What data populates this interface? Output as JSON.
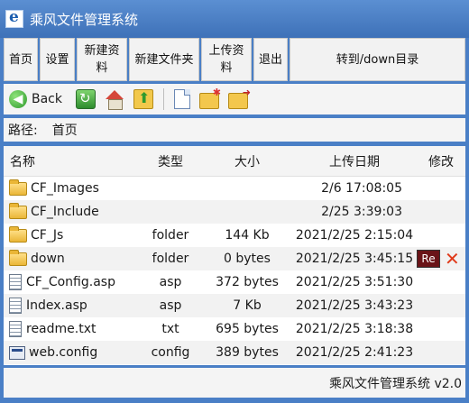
{
  "window": {
    "title": "乘风文件管理系统"
  },
  "nav": {
    "items": [
      {
        "label": "首页"
      },
      {
        "label": "设置"
      },
      {
        "label": "新建资料"
      },
      {
        "label": "新建文件夹"
      },
      {
        "label": "上传资料"
      },
      {
        "label": "退出"
      },
      {
        "label": "转到/down目录"
      }
    ]
  },
  "toolbar": {
    "back_label": "Back",
    "icons": [
      "refresh-icon",
      "home-icon",
      "up-folder-icon",
      "new-file-icon",
      "new-folder-icon",
      "move-folder-icon"
    ]
  },
  "path": {
    "label": "路径:",
    "value": "首页"
  },
  "list": {
    "headers": {
      "name": "名称",
      "type": "类型",
      "size": "大小",
      "date": "上传日期",
      "edit": "修改"
    },
    "rows": [
      {
        "name": "CF_Images",
        "icon": "folder-icon",
        "type": "",
        "size": "",
        "date": "2/6 17:08:05"
      },
      {
        "name": "CF_Include",
        "icon": "folder-icon",
        "type": "",
        "size": "",
        "date": "2/25 3:39:03"
      },
      {
        "name": "CF_Js",
        "icon": "folder-icon",
        "type": "folder",
        "size": "144 Kb",
        "date": "2021/2/25 2:15:04"
      },
      {
        "name": "down",
        "icon": "folder-icon",
        "type": "folder",
        "size": "0 bytes",
        "date": "2021/2/25 3:45:15"
      },
      {
        "name": "CF_Config.asp",
        "icon": "document-icon",
        "type": "asp",
        "size": "372 bytes",
        "date": "2021/2/25 3:51:30"
      },
      {
        "name": "Index.asp",
        "icon": "document-icon",
        "type": "asp",
        "size": "7 Kb",
        "date": "2021/2/25 3:43:23"
      },
      {
        "name": "readme.txt",
        "icon": "document-icon",
        "type": "txt",
        "size": "695 bytes",
        "date": "2021/2/25 3:18:38"
      },
      {
        "name": "web.config",
        "icon": "config-file-icon",
        "type": "config",
        "size": "389 bytes",
        "date": "2021/2/25 2:41:23"
      }
    ],
    "row_actions": {
      "rename_label": "Re",
      "delete_symbol": "✕"
    }
  },
  "status": {
    "text": "乘风文件管理系统 v2.0"
  }
}
